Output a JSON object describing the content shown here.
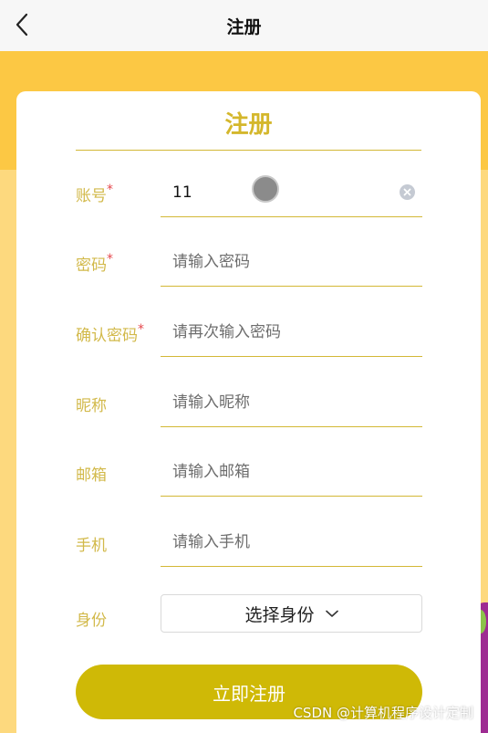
{
  "navbar": {
    "title": "注册",
    "back_icon": "chevron-left-icon"
  },
  "card": {
    "title": "注册"
  },
  "form": {
    "account": {
      "label": "账号",
      "required_mark": "*",
      "value": "11",
      "placeholder": ""
    },
    "password": {
      "label": "密码",
      "required_mark": "*",
      "placeholder": "请输入密码"
    },
    "confirm_password": {
      "label": "确认密码",
      "required_mark": "*",
      "placeholder": "请再次输入密码"
    },
    "nickname": {
      "label": "昵称",
      "placeholder": "请输入昵称"
    },
    "email": {
      "label": "邮箱",
      "placeholder": "请输入邮箱"
    },
    "phone": {
      "label": "手机",
      "placeholder": "请输入手机"
    },
    "identity": {
      "label": "身份",
      "select_text": "选择身份"
    }
  },
  "submit": {
    "label": "立即注册"
  },
  "watermark": "CSDN @计算机程序设计定制",
  "colors": {
    "accent_gold": "#d4b72c",
    "button": "#cfb906",
    "banner": "#fcc844",
    "background": "#fdd97e",
    "required": "#e5484d"
  }
}
